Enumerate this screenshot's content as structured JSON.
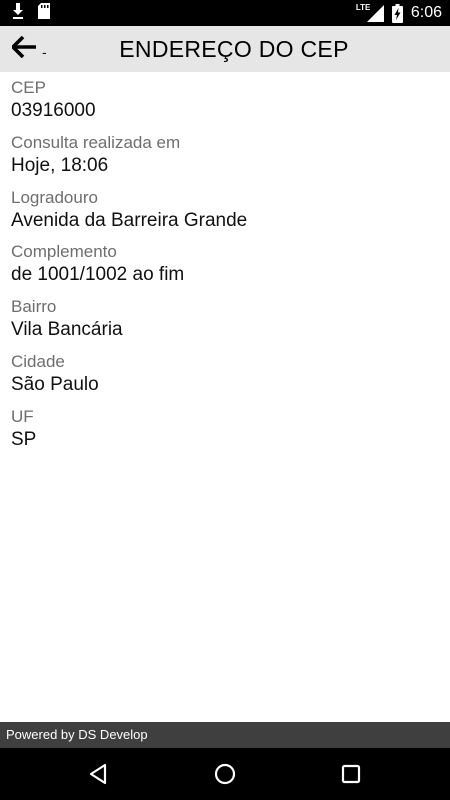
{
  "status_bar": {
    "network": "LTE",
    "time": "6:06",
    "icons": [
      "download-icon",
      "sd-card-icon",
      "signal-icon",
      "battery-charging-icon"
    ]
  },
  "app_bar": {
    "back_suffix": "-",
    "title": "ENDEREÇO DO CEP"
  },
  "fields": [
    {
      "label": "CEP",
      "value": "03916000"
    },
    {
      "label": "Consulta realizada em",
      "value": "Hoje, 18:06"
    },
    {
      "label": "Logradouro",
      "value": "Avenida da Barreira Grande"
    },
    {
      "label": "Complemento",
      "value": "de 1001/1002 ao fim"
    },
    {
      "label": "Bairro",
      "value": "Vila Bancária"
    },
    {
      "label": "Cidade",
      "value": "São Paulo"
    },
    {
      "label": "UF",
      "value": "SP"
    }
  ],
  "footer": {
    "text": "Powered by DS Develop"
  },
  "nav_bar": {
    "icons": [
      "back-triangle-icon",
      "home-circle-icon",
      "recents-square-icon"
    ]
  },
  "colors": {
    "app_bar_bg": "#e6e6e6",
    "footer_bg": "#3f3f3f",
    "label": "#6e6e6e",
    "value": "#111111"
  }
}
